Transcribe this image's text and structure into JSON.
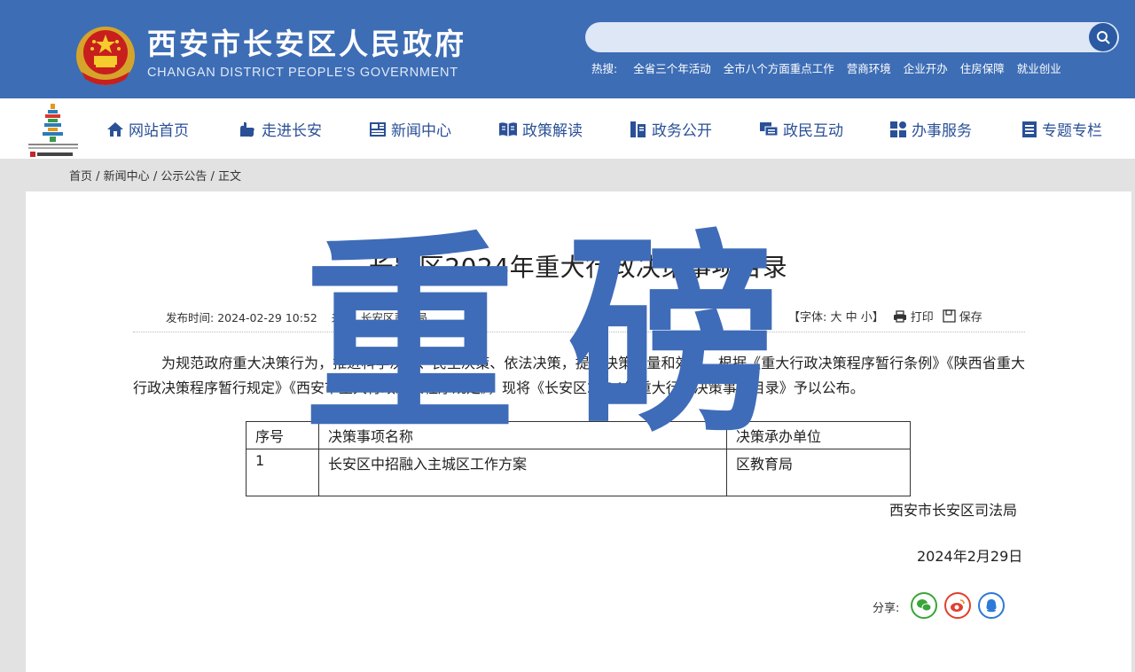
{
  "header": {
    "title": "西安市长安区人民政府",
    "subtitle": "CHANGAN DISTRICT PEOPLE'S GOVERNMENT",
    "search_placeholder": "",
    "hot_label": "热搜:",
    "hot_links": [
      "全省三个年活动",
      "全市八个方面重点工作",
      "营商环境",
      "企业开办",
      "住房保障",
      "就业创业"
    ]
  },
  "nav": {
    "items": [
      {
        "label": "网站首页",
        "icon": "home-icon"
      },
      {
        "label": "走进长安",
        "icon": "hand-icon"
      },
      {
        "label": "新闻中心",
        "icon": "newspaper-icon"
      },
      {
        "label": "政策解读",
        "icon": "book-icon"
      },
      {
        "label": "政务公开",
        "icon": "document-icon"
      },
      {
        "label": "政民互动",
        "icon": "chat-icon"
      },
      {
        "label": "办事服务",
        "icon": "grid-icon"
      },
      {
        "label": "专题专栏",
        "icon": "list-icon"
      }
    ]
  },
  "breadcrumb": [
    "首页",
    "新闻中心",
    "公示公告",
    "正文"
  ],
  "article": {
    "title": "长安区2024年重大行政决策事项目录",
    "publish_label": "发布时间:",
    "publish_time": "2024-02-29 10:52",
    "source_label": "来源:",
    "source": "长安区司法局",
    "font_size_label": "【字体: 大 中 小】",
    "print_label": "打印",
    "save_label": "保存",
    "paragraph": "为规范政府重大决策行为，推进科学决策、民主决策、依法决策，提高决策质量和效率，根据《重大行政决策程序暂行条例》《陕西省重大行政决策程序暂行规定》《西安市重大行政决策程序规定》，现将《长安区2024年重大行政决策事项目录》予以公布。",
    "table": {
      "headers": [
        "序号",
        "决策事项名称",
        "决策承办单位"
      ],
      "rows": [
        [
          "1",
          "长安区中招融入主城区工作方案",
          "区教育局"
        ]
      ]
    },
    "signature_org": "西安市长安区司法局",
    "signature_date": "2024年2月29日",
    "share_label": "分享:"
  },
  "overlay": {
    "char1": "重",
    "char2": "磅"
  },
  "colors": {
    "header_bg": "#3d6db5",
    "nav_text": "#2a5097",
    "overlay": "#3f6cb8"
  }
}
